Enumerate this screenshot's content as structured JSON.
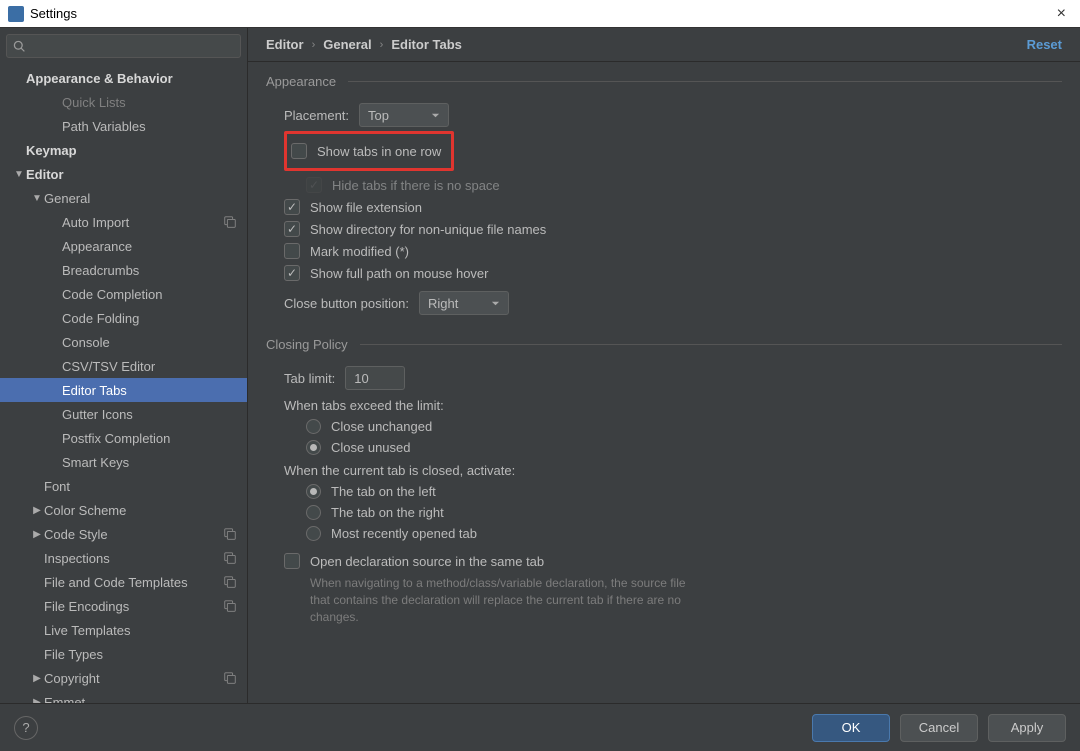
{
  "window": {
    "title": "Settings",
    "close": "×"
  },
  "sidebar": {
    "searchPlaceholder": "",
    "items": [
      {
        "label": "Appearance & Behavior",
        "depth": 0,
        "bold": true,
        "arrow": ""
      },
      {
        "label": "Quick Lists",
        "depth": 2,
        "cutTop": true
      },
      {
        "label": "Path Variables",
        "depth": 2
      },
      {
        "label": "Keymap",
        "depth": 0,
        "bold": true
      },
      {
        "label": "Editor",
        "depth": 0,
        "bold": true,
        "arrow": "▼"
      },
      {
        "label": "General",
        "depth": 1,
        "arrow": "▼"
      },
      {
        "label": "Auto Import",
        "depth": 2,
        "badge": true
      },
      {
        "label": "Appearance",
        "depth": 2
      },
      {
        "label": "Breadcrumbs",
        "depth": 2
      },
      {
        "label": "Code Completion",
        "depth": 2
      },
      {
        "label": "Code Folding",
        "depth": 2
      },
      {
        "label": "Console",
        "depth": 2
      },
      {
        "label": "CSV/TSV Editor",
        "depth": 2
      },
      {
        "label": "Editor Tabs",
        "depth": 2,
        "selected": true
      },
      {
        "label": "Gutter Icons",
        "depth": 2
      },
      {
        "label": "Postfix Completion",
        "depth": 2
      },
      {
        "label": "Smart Keys",
        "depth": 2
      },
      {
        "label": "Font",
        "depth": 1
      },
      {
        "label": "Color Scheme",
        "depth": 1,
        "arrow": "▶"
      },
      {
        "label": "Code Style",
        "depth": 1,
        "arrow": "▶",
        "badge": true
      },
      {
        "label": "Inspections",
        "depth": 1,
        "badge": true
      },
      {
        "label": "File and Code Templates",
        "depth": 1,
        "badge": true
      },
      {
        "label": "File Encodings",
        "depth": 1,
        "badge": true
      },
      {
        "label": "Live Templates",
        "depth": 1
      },
      {
        "label": "File Types",
        "depth": 1
      },
      {
        "label": "Copyright",
        "depth": 1,
        "arrow": "▶",
        "badge": true
      },
      {
        "label": "Emmet",
        "depth": 1,
        "arrow": "▶"
      }
    ]
  },
  "crumbs": [
    "Editor",
    "General",
    "Editor Tabs"
  ],
  "resetLabel": "Reset",
  "appearance": {
    "title": "Appearance",
    "placement": {
      "label": "Placement:",
      "value": "Top"
    },
    "showTabsOneRow": {
      "label": "Show tabs in one row",
      "checked": false
    },
    "hideIfNoSpace": {
      "label": "Hide tabs if there is no space",
      "checked": true
    },
    "showExt": {
      "label": "Show file extension",
      "checked": true
    },
    "showDir": {
      "label": "Show directory for non-unique file names",
      "checked": true
    },
    "markModified": {
      "label": "Mark modified (*)",
      "checked": false
    },
    "fullPathHover": {
      "label": "Show full path on mouse hover",
      "checked": true
    },
    "closeBtn": {
      "label": "Close button position:",
      "value": "Right"
    }
  },
  "closing": {
    "title": "Closing Policy",
    "tabLimit": {
      "label": "Tab limit:",
      "value": "10"
    },
    "exceedLabel": "When tabs exceed the limit:",
    "exceed": [
      {
        "label": "Close unchanged",
        "on": false
      },
      {
        "label": "Close unused",
        "on": true
      }
    ],
    "activateLabel": "When the current tab is closed, activate:",
    "activate": [
      {
        "label": "The tab on the left",
        "on": true
      },
      {
        "label": "The tab on the right",
        "on": false
      },
      {
        "label": "Most recently opened tab",
        "on": false
      }
    ],
    "openDecl": {
      "label": "Open declaration source in the same tab",
      "checked": false
    },
    "openDeclHint": "When navigating to a method/class/variable declaration, the source file that contains the declaration will replace the current tab if there are no changes."
  },
  "buttons": {
    "ok": "OK",
    "cancel": "Cancel",
    "apply": "Apply"
  }
}
